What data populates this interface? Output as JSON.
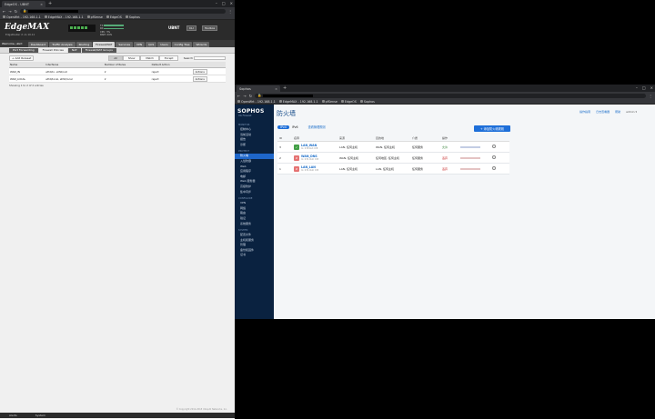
{
  "left_browser": {
    "tab_title": "EdgeOS - UBNT",
    "bookmarks": [
      "OpenWrt - 192.168.1.1",
      "EdgeMAX - 192.168.1.1",
      "pfSense",
      "EdgeOS",
      "Sophos"
    ],
    "edgemax": {
      "logo": "EdgeMAX",
      "subtitle": "EdgeRouter X v1.10.11",
      "stats": [
        "TX",
        "RX",
        "CPU: 3%",
        "RAM: 24%"
      ],
      "ubnt": "UBNT",
      "btn_cli": "CLI",
      "btn_toolbox": "Toolbox",
      "welcome": "Welcome, ubnt",
      "nav": [
        "Dashboard",
        "Traffic Analysis",
        "Routing",
        "Firewall/NAT",
        "Services",
        "VPN",
        "QoS",
        "Users",
        "Config Tree",
        "Wizards"
      ],
      "nav_active": 3,
      "subnav": [
        "Port Forwarding",
        "Firewall Policies",
        "NAT",
        "Firewall/NAT Groups"
      ],
      "subnav_active": 1,
      "add_button": "+ Add Ruleset",
      "filters": [
        "All",
        "Show",
        "Match",
        "Except"
      ],
      "search_label": "Search",
      "columns": [
        "Name",
        "Interfaces",
        "Number of Rules",
        "Default Action",
        ""
      ],
      "rows": [
        {
          "name": "WAN_IN",
          "interfaces": "eth0/in, eth0/out",
          "rules": "2",
          "action": "reject",
          "actions": "Actions"
        },
        {
          "name": "WAN_LOCAL",
          "interfaces": "eth0/local, eth0/local",
          "rules": "2",
          "action": "reject",
          "actions": "Actions"
        }
      ],
      "count_text": "Showing 1 to 2 of 2 entries",
      "footer": "© Copyright 2012-2018 Ubiquiti Networks, Inc.",
      "status": [
        "Alerts",
        "System"
      ]
    }
  },
  "right_browser": {
    "tab_title": "Sophos",
    "bookmarks": [
      "OpenWrt - 192.168.1.1",
      "EdgeMAX - 192.168.1.1",
      "pfSense",
      "EdgeOS",
      "Sophos"
    ],
    "sidebar": {
      "logo": "SOPHOS",
      "logo_sub": "XG Firewall",
      "sections": [
        {
          "title": "MONITOR",
          "items": [
            "控制中心",
            "当前活动",
            "报告",
            "诊断"
          ]
        },
        {
          "title": "PROTECT",
          "items": [
            "防火墙",
            "入侵防御",
            "Web",
            "应用程序",
            "电邮",
            "Web 服务器",
            "高级防护",
            "集中同步"
          ]
        },
        {
          "title": "CONFIGURE",
          "items": [
            "VPN",
            "网络",
            "路由",
            "验证",
            "系统服务"
          ]
        },
        {
          "title": "SYSTEM",
          "items": [
            "配置文件",
            "主机和服务",
            "管理",
            "备份和固件",
            "证书"
          ]
        }
      ],
      "active": "防火墙"
    },
    "main": {
      "title": "防火墙",
      "top_links": [
        "操作指南",
        "日志查看器",
        "帮助"
      ],
      "user": "admin ▾",
      "tab_ipv4": "IPv4",
      "tab_ipv6": "IPv6",
      "link_rules": "查看管理规则",
      "add_button": "+ 添加防火墙规则",
      "columns": [
        "ID",
        "名称",
        "来源",
        "目的地",
        "介质",
        "操作",
        "",
        ""
      ],
      "rules": [
        {
          "id": "3",
          "name": "LAN_WAN",
          "sub": "In: 0 B Out: 0 B",
          "source": "LAN, 任何主机",
          "dest": "WAN, 任何主机",
          "service": "任何服务",
          "action": "允许",
          "status": "on",
          "color": "#43a047"
        },
        {
          "id": "2",
          "name": "WAN_DNS",
          "sub": "In: 0 B, Out: 0 B",
          "source": "WAN, 任何主机",
          "dest": "任何地区, 任何主机",
          "service": "任何服务",
          "action": "丢弃",
          "status": "off",
          "color": "#e57373"
        },
        {
          "id": "1",
          "name": "LAN_LAN",
          "sub": "In: 0 B, Out: 0 B",
          "source": "LAN, 任何主机",
          "dest": "LAN, 任何主机",
          "service": "任何服务",
          "action": "丢弃",
          "status": "off",
          "color": "#e57373"
        }
      ]
    }
  }
}
